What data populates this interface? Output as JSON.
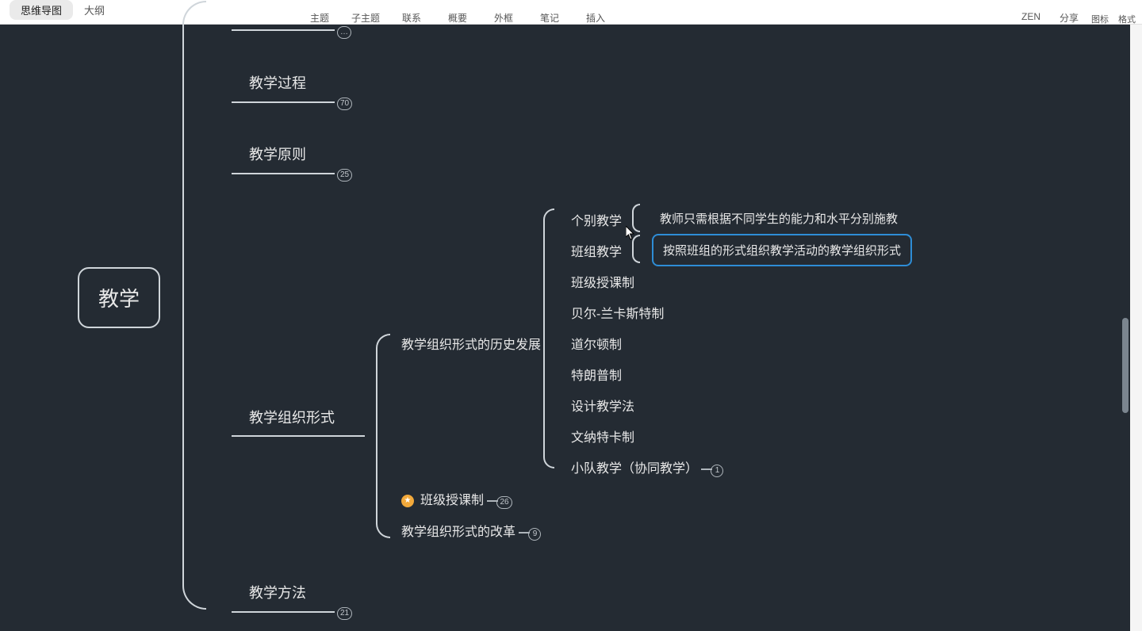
{
  "viewTabs": {
    "mindmap": "思维导图",
    "outline": "大纲"
  },
  "tools": {
    "topic": "主题",
    "subtopic": "子主题",
    "relation": "联系",
    "summary": "概要",
    "border": "外框",
    "note": "笔记",
    "insert": "插入"
  },
  "rightTools": {
    "zen": "ZEN",
    "share": "分享"
  },
  "farTools": {
    "icons": "图标",
    "format": "格式"
  },
  "root": "教学",
  "level1": {
    "n0": {
      "label": "",
      "count": "…"
    },
    "n1": {
      "label": "教学过程",
      "count": "70"
    },
    "n2": {
      "label": "教学原则",
      "count": "25"
    },
    "n3": {
      "label": "教学组织形式"
    },
    "n4": {
      "label": "教学方法",
      "count": "21"
    }
  },
  "orgChildren": {
    "c1": {
      "label": "教学组织形式的历史发展"
    },
    "c2": {
      "label": "班级授课制",
      "count": "26",
      "star": true
    },
    "c3": {
      "label": "教学组织形式的改革",
      "count": "9"
    }
  },
  "history": {
    "h1": {
      "label": "个别教学",
      "desc": "教师只需根据不同学生的能力和水平分别施教"
    },
    "h2": {
      "label": "班组教学",
      "desc": "按照班组的形式组织教学活动的教学组织形式",
      "selected": true
    },
    "h3": {
      "label": "班级授课制"
    },
    "h4": {
      "label": "贝尔-兰卡斯特制"
    },
    "h5": {
      "label": "道尔顿制"
    },
    "h6": {
      "label": "特朗普制"
    },
    "h7": {
      "label": "设计教学法"
    },
    "h8": {
      "label": "文纳特卡制"
    },
    "h9": {
      "label": "小队教学（协同教学）",
      "count": "1"
    }
  }
}
